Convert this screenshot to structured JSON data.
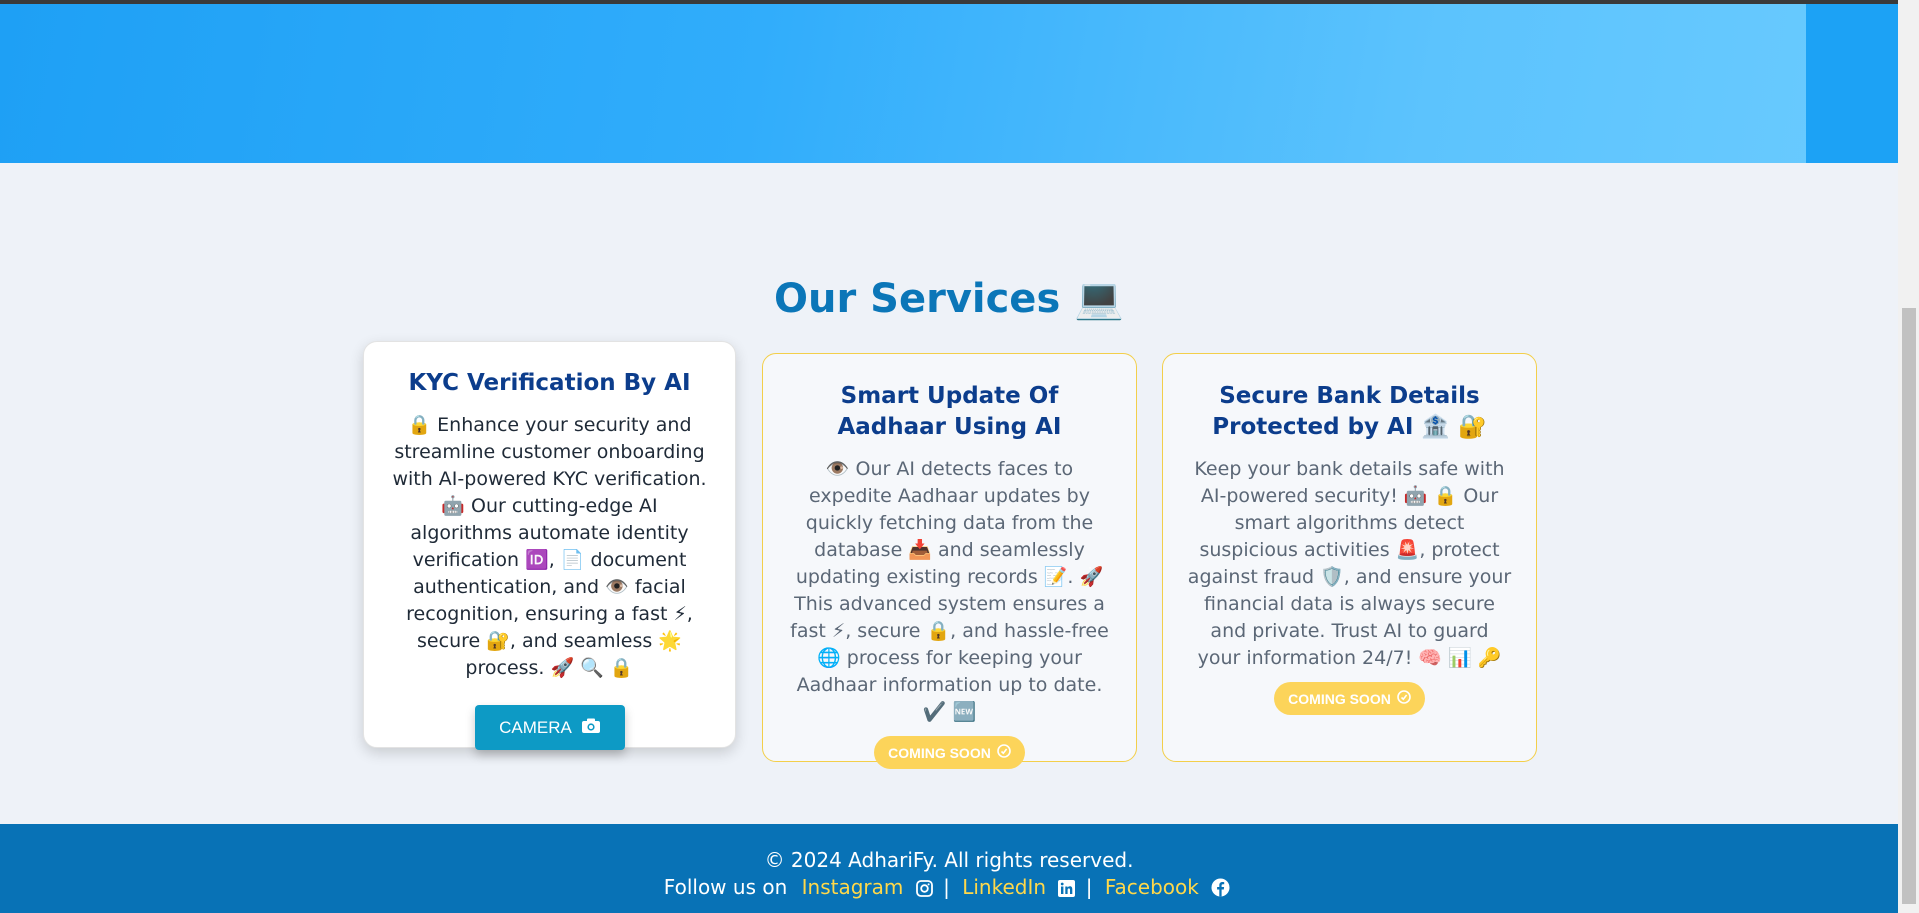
{
  "services": {
    "heading": "Our Services 💻"
  },
  "cards": [
    {
      "title": "KYC Verification By AI",
      "description": "🔒 Enhance your security and streamline customer onboarding with AI-powered KYC verification. 🤖 Our cutting-edge AI algorithms automate identity verification 🆔, 📄 document authentication, and 👁️ facial recognition, ensuring a fast ⚡, secure 🔐, and seamless 🌟 process. 🚀 🔍 🔒",
      "button_label": "CAMERA"
    },
    {
      "title": "Smart Update Of Aadhaar Using AI",
      "description": "👁️ Our AI detects faces to expedite Aadhaar updates by quickly fetching data from the database 📥 and seamlessly updating existing records 📝. 🚀 This advanced system ensures a fast ⚡, secure 🔒, and hassle-free 🌐 process for keeping your Aadhaar information up to date. ✔️ 🆕",
      "badge": "COMING SOON"
    },
    {
      "title": "Secure Bank Details Protected by AI 🏦 🔐",
      "description": "Keep your bank details safe with AI-powered security! 🤖 🔒 Our smart algorithms detect suspicious activities 🚨, protect against fraud 🛡️, and ensure your financial data is always secure and private. Trust AI to guard your information 24/7! 🧠 📊 🔑",
      "badge": "COMING SOON"
    }
  ],
  "footer": {
    "copyright": "© 2024 AdhariFy. All rights reserved.",
    "follow_label": "Follow us on",
    "links": {
      "instagram": "Instagram",
      "linkedin": "LinkedIn",
      "facebook": "Facebook"
    },
    "separator": "|"
  },
  "icons": {
    "services": "laptop-icon",
    "camera": "camera-icon",
    "coming_soon": "clock-icon",
    "instagram": "instagram-icon",
    "linkedin": "linkedin-icon",
    "facebook": "facebook-icon"
  },
  "colors": {
    "hero_start": "#1ea0f5",
    "hero_end": "#6acbff",
    "heading": "#0b76b8",
    "card_title": "#0c3d8c",
    "camera_button": "#0d9ac5",
    "badge": "#fcd45a",
    "footer": "#0872b6",
    "footer_link": "#ffd84a"
  }
}
